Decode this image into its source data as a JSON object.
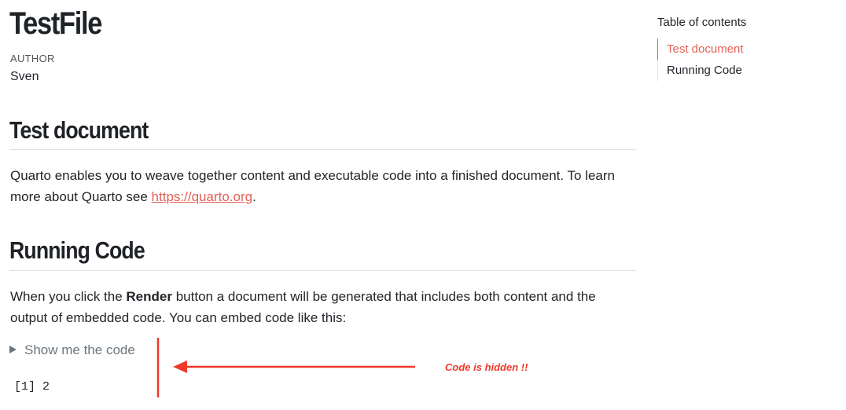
{
  "document": {
    "title": "TestFile",
    "author_label": "AUTHOR",
    "author_name": "Sven"
  },
  "sections": [
    {
      "heading": "Test document",
      "text_before_link": "Quarto enables you to weave together content and executable code into a finished document. To learn more about Quarto see ",
      "link_text": "https://quarto.org",
      "text_after_link": "."
    },
    {
      "heading": "Running Code",
      "text_before_bold": "When you click the ",
      "bold_text": "Render",
      "text_after_bold": " button a document will be generated that includes both content and the output of embedded code. You can embed code like this:",
      "code_fold_label": "Show me the code",
      "output": "[1] 2"
    }
  ],
  "toc": {
    "title": "Table of contents",
    "items": [
      {
        "label": "Test document",
        "active": true
      },
      {
        "label": "Running Code",
        "active": false
      }
    ]
  },
  "annotation": {
    "text": "Code is hidden !!",
    "color": "#f0392b"
  },
  "colors": {
    "link": "#e45f55",
    "text": "#212529",
    "muted": "#6c757d",
    "rule": "#dee2e6"
  }
}
